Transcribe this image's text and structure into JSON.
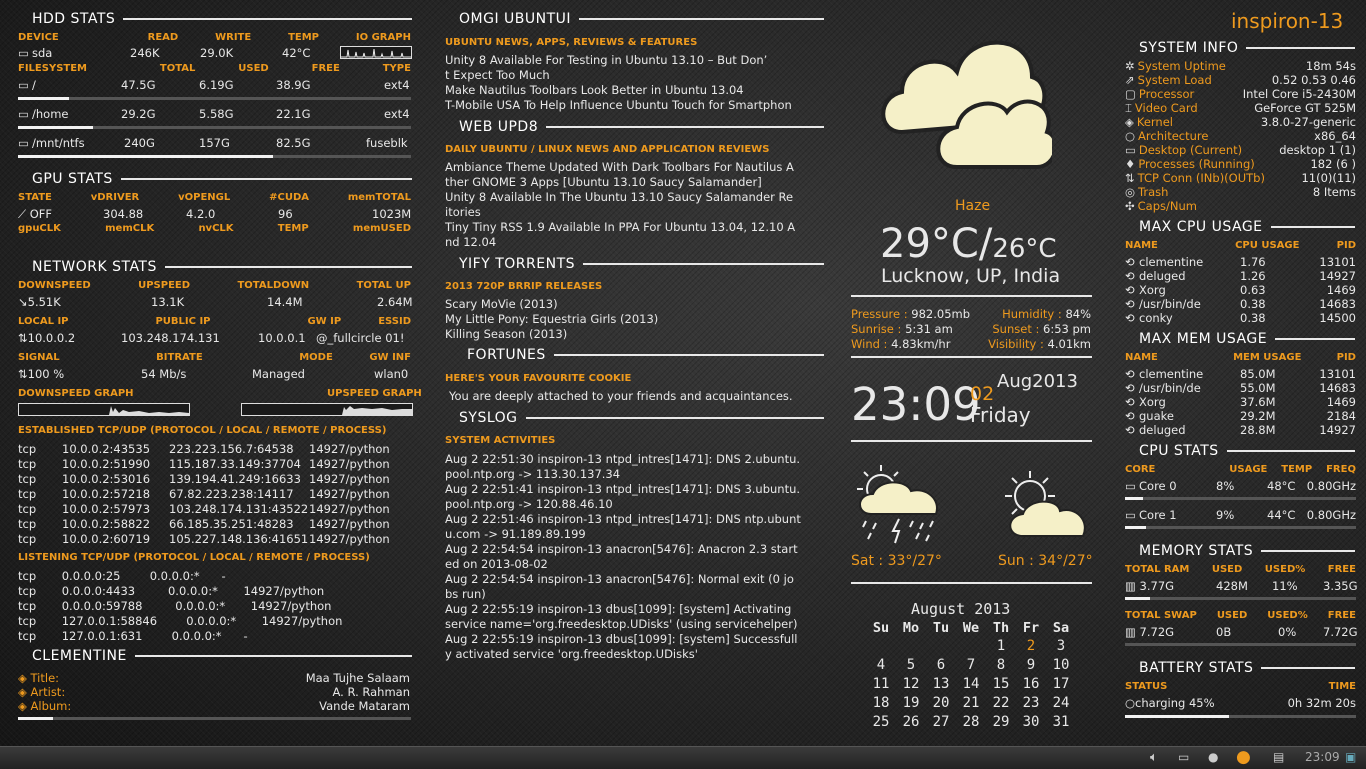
{
  "hdd": {
    "title": "HDD STATS",
    "head1": [
      "DEVICE",
      "READ",
      "WRITE",
      "TEMP",
      "IO GRAPH"
    ],
    "dev": {
      "name": "sda",
      "read": "246K",
      "write": "29.0K",
      "temp": "42°C"
    },
    "head2": [
      "FILESYSTEM",
      "TOTAL",
      "USED",
      "FREE",
      "TYPE"
    ],
    "fs": [
      {
        "mount": "/",
        "total": "47.5G",
        "used": "6.19G",
        "free": "38.9G",
        "type": "ext4",
        "pct": 13
      },
      {
        "mount": "/home",
        "total": "29.2G",
        "used": "5.58G",
        "free": "22.1G",
        "type": "ext4",
        "pct": 19
      },
      {
        "mount": "/mnt/ntfs",
        "total": "240G",
        "used": "157G",
        "free": "82.5G",
        "type": "fuseblk",
        "pct": 65
      }
    ]
  },
  "gpu": {
    "title": "GPU STATS",
    "head1": [
      "STATE",
      "vDRIVER",
      "vOPENGL",
      "#CUDA",
      "memTOTAL"
    ],
    "vals": [
      "OFF",
      "304.88",
      "4.2.0",
      "96",
      "1023M"
    ],
    "head2": [
      "gpuCLK",
      "memCLK",
      "nvCLK",
      "TEMP",
      "memUSED"
    ]
  },
  "net": {
    "title": "NETWORK STATS",
    "head1": [
      "DOWNSPEED",
      "UPSPEED",
      "TOTALDOWN",
      "TOTAL UP"
    ],
    "vals1": [
      "5.51K",
      "13.1K",
      "14.4M",
      "2.64M"
    ],
    "head2": [
      "LOCAL IP",
      "PUBLIC IP",
      "GW IP",
      "ESSID"
    ],
    "vals2": [
      "10.0.0.2",
      "103.248.174.131",
      "10.0.0.1",
      "@_fullcircle 01!"
    ],
    "head3": [
      "SIGNAL",
      "BITRATE",
      "MODE",
      "GW INF"
    ],
    "vals3": [
      "100  %",
      "54 Mb/s",
      "Managed",
      "wlan0"
    ],
    "graph_down": "DOWNSPEED GRAPH",
    "graph_up": "UPSPEED GRAPH",
    "est_title": "ESTABLISHED TCP/UDP (PROTOCOL  / LOCAL / REMOTE / PROCESS)",
    "est": [
      [
        "tcp",
        "10.0.0.2:43535",
        "223.223.156.7:64538",
        "14927/python"
      ],
      [
        "tcp",
        "10.0.0.2:51990",
        "115.187.33.149:37704",
        "14927/python"
      ],
      [
        "tcp",
        "10.0.0.2:53016",
        "139.194.41.249:16633",
        "14927/python"
      ],
      [
        "tcp",
        "10.0.0.2:57218",
        "67.82.223.238:14117",
        "14927/python"
      ],
      [
        "tcp",
        "10.0.0.2:57973",
        "103.248.174.131:43522",
        "14927/python"
      ],
      [
        "tcp",
        "10.0.0.2:58822",
        "66.185.35.251:48283",
        "14927/python"
      ],
      [
        "tcp",
        "10.0.0.2:60719",
        "105.227.148.136:41651",
        "14927/python"
      ]
    ],
    "lis_title": "LISTENING TCP/UDP (PROTOCOL  / LOCAL / REMOTE / PROCESS)",
    "lis": [
      "tcp       0.0.0.0:25        0.0.0.0:*      -",
      "tcp       0.0.0.0:4433         0.0.0.0:*       14927/python",
      "tcp       0.0.0.0:59788         0.0.0.0:*       14927/python",
      "tcp       127.0.0.1:58846        0.0.0.0:*       14927/python",
      "tcp       127.0.0.1:631        0.0.0.0:*      -"
    ]
  },
  "clem": {
    "title": "CLEMENTINE",
    "labels": [
      "Title:",
      "Artist:",
      "Album:"
    ],
    "vals": [
      "Maa Tujhe Salaam",
      "A. R. Rahman",
      "Vande Mataram"
    ]
  },
  "news": {
    "title1": "OMGI UBUNTUI",
    "sub1": "UBUNTU NEWS, APPS, REVIEWS & FEATURES",
    "items1": [
      "Unity 8 Available For Testing in Ubuntu 13.10 – But Don’",
      "t Expect Too Much",
      "Make Nautilus Toolbars Look Better in Ubuntu 13.04",
      "T-Mobile USA To Help Influence Ubuntu Touch for Smartphon"
    ],
    "title2": "WEB UPD8",
    "sub2": "DAILY UBUNTU / LINUX NEWS AND APPLICATION REVIEWS",
    "items2": [
      "Ambiance Theme Updated With Dark Toolbars For Nautilus A",
      "ther GNOME 3 Apps [Ubuntu 13.10 Saucy Salamander]",
      "Unity 8 Available In The Ubuntu 13.10 Saucy Salamander Re",
      "itories",
      "Tiny Tiny RSS 1.9 Available In PPA For Ubuntu 13.04, 12.10 A",
      "nd 12.04"
    ],
    "title3": "YIFY TORRENTS",
    "sub3": "2013 720P BRRIP RELEASES",
    "items3": [
      "Scary MoVie (2013)",
      "My Little Pony: Equestria Girls (2013)",
      "Killing Season (2013)"
    ],
    "title4": "FORTUNES",
    "sub4": "HERE'S YOUR FAVOURITE COOKIE",
    "fortune": "You are deeply attached to your friends and acquaintances.",
    "title5": "SYSLOG",
    "sub5": "SYSTEM ACTIVITIES",
    "syslog": [
      "Aug  2 22:51:30 inspiron-13 ntpd_intres[1471]: DNS 2.ubuntu.",
      "pool.ntp.org -> 113.30.137.34",
      "Aug  2 22:51:41 inspiron-13 ntpd_intres[1471]: DNS 3.ubuntu.",
      "pool.ntp.org -> 120.88.46.10",
      "Aug  2 22:51:46 inspiron-13 ntpd_intres[1471]: DNS ntp.ubunt",
      "u.com -> 91.189.89.199",
      "Aug  2 22:54:54 inspiron-13 anacron[5476]: Anacron 2.3 start",
      "ed on 2013-08-02",
      "Aug  2 22:54:54 inspiron-13 anacron[5476]: Normal exit (0 jo",
      "bs run)",
      "Aug  2 22:55:19 inspiron-13 dbus[1099]: [system] Activating",
      "service name='org.freedesktop.UDisks' (using servicehelper)",
      "Aug  2 22:55:19 inspiron-13 dbus[1099]: [system] Successfull",
      "y activated service 'org.freedesktop.UDisks'"
    ]
  },
  "weather": {
    "cond": "Haze",
    "temp": "29°C/",
    "feels": "26°C",
    "city": "Lucknow, UP, India",
    "pressure_l": "Pressure :",
    "pressure": "982.05mb",
    "humidity_l": "Humidity :",
    "humidity": "84%",
    "sunrise_l": "Sunrise :",
    "sunrise": "5:31 am",
    "sunset_l": "Sunset :",
    "sunset": "6:53 pm",
    "wind_l": "Wind :",
    "wind": "4.83km/hr",
    "vis_l": "Visibility :",
    "vis": "4.01km",
    "f1": "Sat : 33°/27°",
    "f2": "Sun : 34°/27°"
  },
  "clock": {
    "time": "23:09",
    "day": "02",
    "monthyear": "Aug2013",
    "weekday": "Friday"
  },
  "calendar": {
    "title": "August  2013",
    "days": [
      "Su",
      "Mo",
      "Tu",
      "We",
      "Th",
      "Fr",
      "Sa"
    ],
    "weeks": [
      [
        "",
        "",
        "",
        "",
        "1",
        "2",
        "3"
      ],
      [
        "4",
        "5",
        "6",
        "7",
        "8",
        "9",
        "10"
      ],
      [
        "11",
        "12",
        "13",
        "14",
        "15",
        "16",
        "17"
      ],
      [
        "18",
        "19",
        "20",
        "21",
        "22",
        "23",
        "24"
      ],
      [
        "25",
        "26",
        "27",
        "28",
        "29",
        "30",
        "31"
      ]
    ],
    "today": "2"
  },
  "host": "inspiron-13",
  "sys": {
    "title": "SYSTEM INFO",
    "rows": [
      [
        "System Uptime",
        "18m 54s"
      ],
      [
        "System Load",
        "0.52 0.53 0.46"
      ],
      [
        "Processor",
        "Intel Core i5-2430M"
      ],
      [
        "Video Card",
        "GeForce GT 525M"
      ],
      [
        "Kernel",
        "3.8.0-27-generic"
      ],
      [
        "Architecture",
        "x86_64"
      ],
      [
        "Desktop (Current)",
        "desktop 1 (1)"
      ],
      [
        "Processes (Running)",
        "182  (6   )"
      ],
      [
        "TCP Conn (INb)(OUTb)",
        "11(0)(11)"
      ],
      [
        "Trash",
        "8 Items"
      ],
      [
        "Caps/Num",
        ""
      ]
    ]
  },
  "cpuTop": {
    "title": "MAX CPU USAGE",
    "head": [
      "NAME",
      "CPU USAGE",
      "PID"
    ],
    "rows": [
      [
        "clementine",
        "1.76",
        "13101"
      ],
      [
        "deluged",
        "1.26",
        "14927"
      ],
      [
        "Xorg",
        "0.63",
        "1469"
      ],
      [
        "/usr/bin/de",
        "0.38",
        "14683"
      ],
      [
        "conky",
        "0.38",
        "14500"
      ]
    ]
  },
  "memTop": {
    "title": "MAX MEM USAGE",
    "head": [
      "NAME",
      "MEM USAGE",
      "PID"
    ],
    "rows": [
      [
        "clementine",
        "85.0M",
        "13101"
      ],
      [
        "/usr/bin/de",
        "55.0M",
        "14683"
      ],
      [
        "Xorg",
        "37.6M",
        "1469"
      ],
      [
        "guake",
        "29.2M",
        "2184"
      ],
      [
        "deluged",
        "28.8M",
        "14927"
      ]
    ]
  },
  "cpu": {
    "title": "CPU STATS",
    "head": [
      "CORE",
      "USAGE",
      "TEMP",
      "FREQ"
    ],
    "rows": [
      [
        "Core 0",
        "8%",
        "48°C",
        "0.80GHz",
        8
      ],
      [
        "Core 1",
        "9%",
        "44°C",
        "0.80GHz",
        9
      ]
    ]
  },
  "mem": {
    "title": "MEMORY STATS",
    "head1": [
      "TOTAL RAM",
      "USED",
      "USED%",
      "FREE"
    ],
    "ram": [
      "3.77G",
      "428M",
      "11%",
      "3.35G"
    ],
    "ram_pct": 11,
    "head2": [
      "TOTAL SWAP",
      "USED",
      "USED%",
      "FREE"
    ],
    "swap": [
      "7.72G",
      "0B",
      "0%",
      "7.72G"
    ],
    "swap_pct": 0
  },
  "bat": {
    "title": "BATTERY STATS",
    "head": [
      "STATUS",
      "TIME"
    ],
    "status": "charging 45%",
    "time": "0h 32m 20s",
    "pct": 45
  },
  "taskbar": {
    "time": "23:09"
  }
}
